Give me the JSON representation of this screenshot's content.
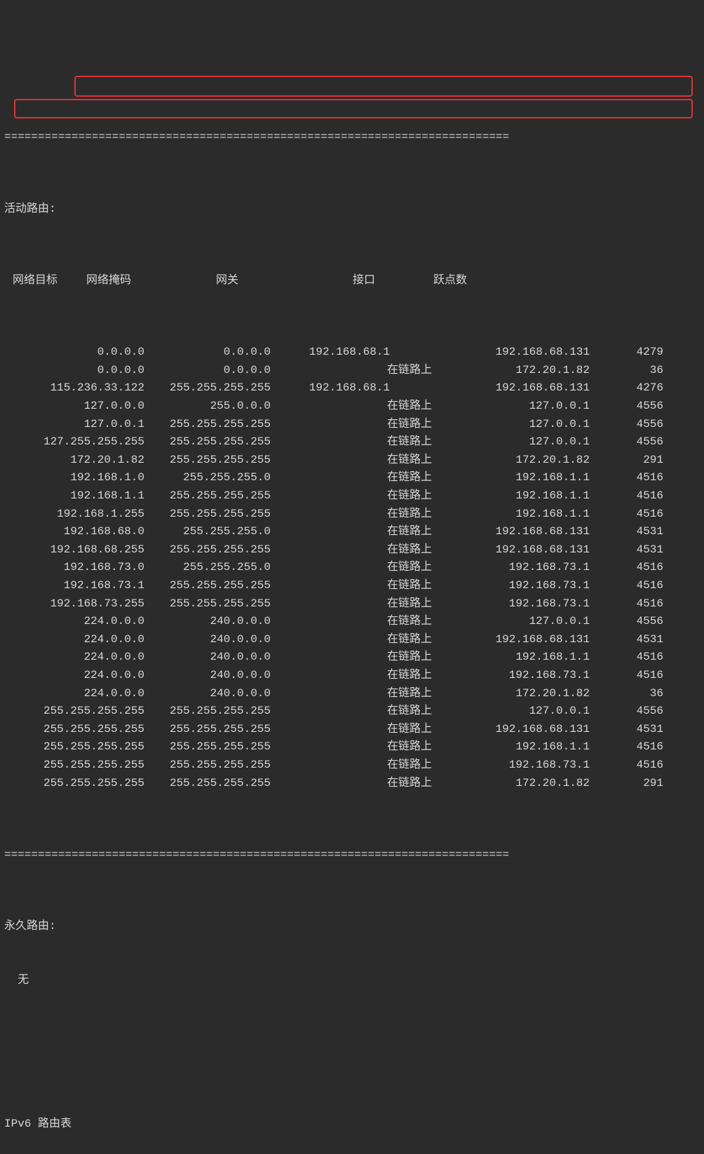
{
  "separator": "===========================================================================",
  "active_routes_label": "活动路由:",
  "headers": {
    "dest": "网络目标",
    "mask": "网络掩码",
    "gateway": "网关",
    "iface": "接口",
    "metric": "跃点数"
  },
  "routes": [
    {
      "dest": "0.0.0.0",
      "mask": "0.0.0.0",
      "gw": "192.168.68.1",
      "iface": "192.168.68.131",
      "metric": "4279"
    },
    {
      "dest": "0.0.0.0",
      "mask": "0.0.0.0",
      "gw": "在链路上",
      "iface": "172.20.1.82",
      "metric": "36"
    },
    {
      "dest": "115.236.33.122",
      "mask": "255.255.255.255",
      "gw": "192.168.68.1",
      "iface": "192.168.68.131",
      "metric": "4276"
    },
    {
      "dest": "127.0.0.0",
      "mask": "255.0.0.0",
      "gw": "在链路上",
      "iface": "127.0.0.1",
      "metric": "4556"
    },
    {
      "dest": "127.0.0.1",
      "mask": "255.255.255.255",
      "gw": "在链路上",
      "iface": "127.0.0.1",
      "metric": "4556"
    },
    {
      "dest": "127.255.255.255",
      "mask": "255.255.255.255",
      "gw": "在链路上",
      "iface": "127.0.0.1",
      "metric": "4556"
    },
    {
      "dest": "172.20.1.82",
      "mask": "255.255.255.255",
      "gw": "在链路上",
      "iface": "172.20.1.82",
      "metric": "291"
    },
    {
      "dest": "192.168.1.0",
      "mask": "255.255.255.0",
      "gw": "在链路上",
      "iface": "192.168.1.1",
      "metric": "4516"
    },
    {
      "dest": "192.168.1.1",
      "mask": "255.255.255.255",
      "gw": "在链路上",
      "iface": "192.168.1.1",
      "metric": "4516"
    },
    {
      "dest": "192.168.1.255",
      "mask": "255.255.255.255",
      "gw": "在链路上",
      "iface": "192.168.1.1",
      "metric": "4516"
    },
    {
      "dest": "192.168.68.0",
      "mask": "255.255.255.0",
      "gw": "在链路上",
      "iface": "192.168.68.131",
      "metric": "4531"
    },
    {
      "dest": "192.168.68.255",
      "mask": "255.255.255.255",
      "gw": "在链路上",
      "iface": "192.168.68.131",
      "metric": "4531"
    },
    {
      "dest": "192.168.73.0",
      "mask": "255.255.255.0",
      "gw": "在链路上",
      "iface": "192.168.73.1",
      "metric": "4516"
    },
    {
      "dest": "192.168.73.1",
      "mask": "255.255.255.255",
      "gw": "在链路上",
      "iface": "192.168.73.1",
      "metric": "4516"
    },
    {
      "dest": "192.168.73.255",
      "mask": "255.255.255.255",
      "gw": "在链路上",
      "iface": "192.168.73.1",
      "metric": "4516"
    },
    {
      "dest": "224.0.0.0",
      "mask": "240.0.0.0",
      "gw": "在链路上",
      "iface": "127.0.0.1",
      "metric": "4556"
    },
    {
      "dest": "224.0.0.0",
      "mask": "240.0.0.0",
      "gw": "在链路上",
      "iface": "192.168.68.131",
      "metric": "4531"
    },
    {
      "dest": "224.0.0.0",
      "mask": "240.0.0.0",
      "gw": "在链路上",
      "iface": "192.168.1.1",
      "metric": "4516"
    },
    {
      "dest": "224.0.0.0",
      "mask": "240.0.0.0",
      "gw": "在链路上",
      "iface": "192.168.73.1",
      "metric": "4516"
    },
    {
      "dest": "224.0.0.0",
      "mask": "240.0.0.0",
      "gw": "在链路上",
      "iface": "172.20.1.82",
      "metric": "36"
    },
    {
      "dest": "255.255.255.255",
      "mask": "255.255.255.255",
      "gw": "在链路上",
      "iface": "127.0.0.1",
      "metric": "4556"
    },
    {
      "dest": "255.255.255.255",
      "mask": "255.255.255.255",
      "gw": "在链路上",
      "iface": "192.168.68.131",
      "metric": "4531"
    },
    {
      "dest": "255.255.255.255",
      "mask": "255.255.255.255",
      "gw": "在链路上",
      "iface": "192.168.1.1",
      "metric": "4516"
    },
    {
      "dest": "255.255.255.255",
      "mask": "255.255.255.255",
      "gw": "在链路上",
      "iface": "192.168.73.1",
      "metric": "4516"
    },
    {
      "dest": "255.255.255.255",
      "mask": "255.255.255.255",
      "gw": "在链路上",
      "iface": "172.20.1.82",
      "metric": "291"
    }
  ],
  "permanent_routes_label": "永久路由:",
  "permanent_routes_value": "  无",
  "ipv6_label": "IPv6 路由表"
}
